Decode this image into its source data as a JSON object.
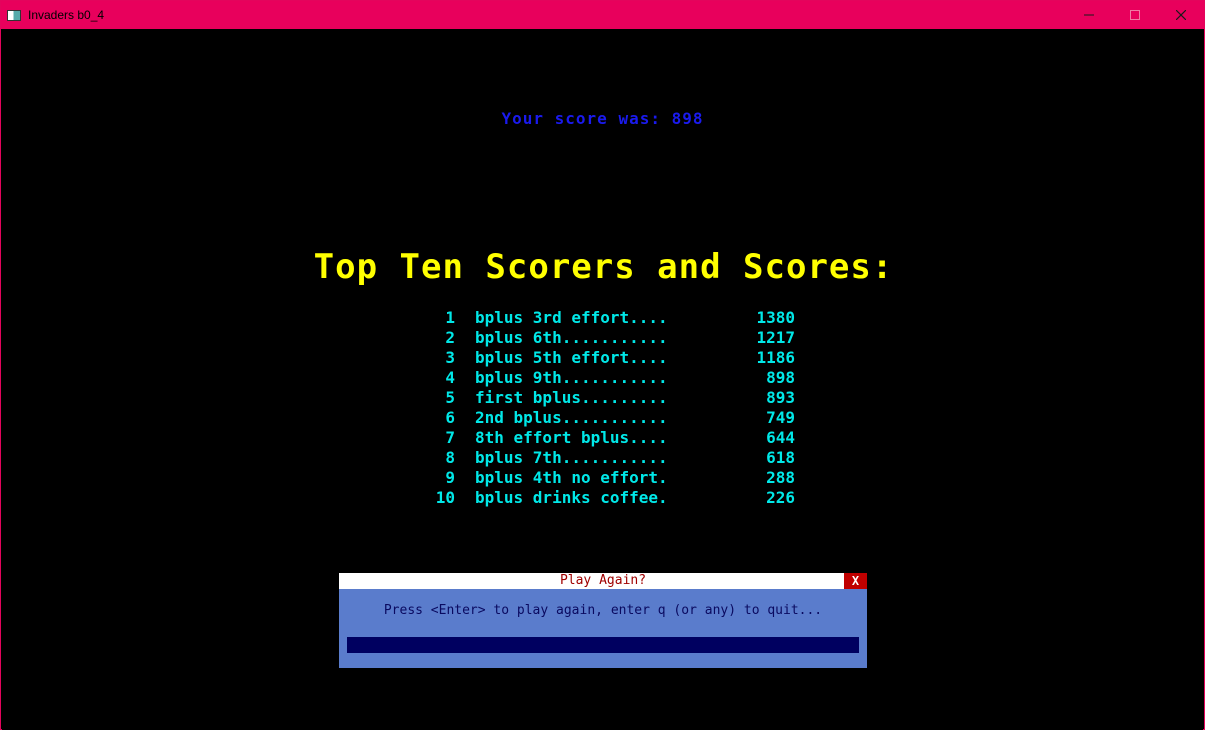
{
  "window": {
    "title": "Invaders b0_4",
    "minimize_icon": "minimize-icon",
    "maximize_icon": "maximize-icon",
    "close_icon": "close-icon"
  },
  "game": {
    "your_score_text": "Your score was: 898",
    "heading": "Top Ten Scorers and Scores:",
    "scores": [
      {
        "rank": "1",
        "name": "bplus 3rd effort....",
        "score": "1380"
      },
      {
        "rank": "2",
        "name": "bplus 6th...........",
        "score": "1217"
      },
      {
        "rank": "3",
        "name": "bplus 5th effort....",
        "score": "1186"
      },
      {
        "rank": "4",
        "name": "bplus 9th...........",
        "score": "898"
      },
      {
        "rank": "5",
        "name": "first bplus.........",
        "score": "893"
      },
      {
        "rank": "6",
        "name": "2nd bplus...........",
        "score": "749"
      },
      {
        "rank": "7",
        "name": "8th effort bplus....",
        "score": "644"
      },
      {
        "rank": "8",
        "name": "bplus 7th...........",
        "score": "618"
      },
      {
        "rank": "9",
        "name": "bplus 4th no effort.",
        "score": "288"
      },
      {
        "rank": "10",
        "name": "bplus drinks coffee.",
        "score": "226"
      }
    ]
  },
  "dialog": {
    "title": "Play Again?",
    "close_label": "X",
    "message": "Press <Enter> to play again, enter q (or any) to quit...",
    "input_value": ""
  },
  "colors": {
    "titlebar": "#e8005c",
    "score_text": "#1a1aee",
    "heading": "#ffff00",
    "table_text": "#00e8e8",
    "dialog_bg": "#5a7ccc",
    "dialog_title": "#a00000",
    "input_bg": "#000060"
  }
}
